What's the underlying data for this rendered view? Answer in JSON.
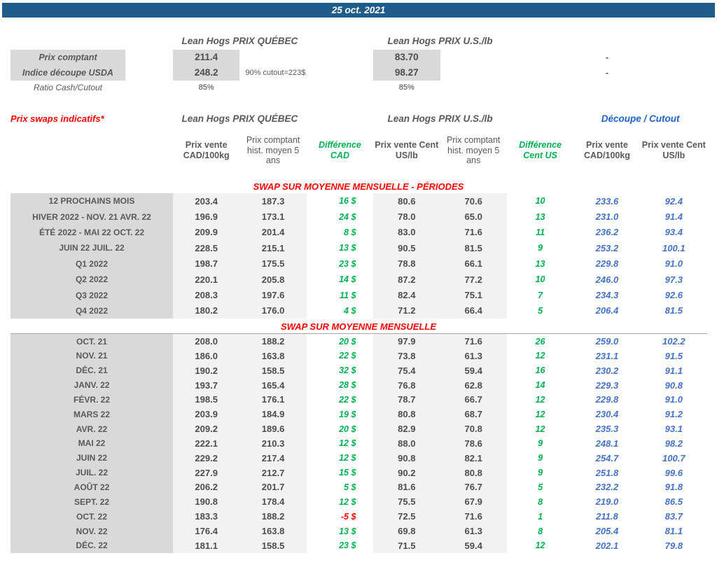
{
  "colors": {
    "banner_bg": "#1F5C8B",
    "section_red": "#FF0000",
    "difference_green": "#00B050",
    "cutout_blue": "#4472C4",
    "cutout_header_blue": "#2064C8",
    "label_column_bg": "#D9D9D9",
    "data_band_bg": "#F2F2F2"
  },
  "banner": {
    "date": "25 oct. 2021"
  },
  "spot": {
    "quebec_header": "Lean Hogs PRIX QUÉBEC",
    "us_header": "Lean Hogs PRIX U.S./lb",
    "rows": [
      {
        "label": "Prix comptant",
        "qc": "211.4",
        "note": "",
        "us": "83.70",
        "cutout_cad": "-"
      },
      {
        "label": "Indice découpe USDA",
        "qc": "248.2",
        "note": "90% cutout=223$",
        "us": "98.27",
        "cutout_cad": "-"
      },
      {
        "label": "Ratio Cash/Cutout",
        "qc": "85%",
        "note": "",
        "us": "85%",
        "cutout_cad": ""
      }
    ]
  },
  "swaps": {
    "note": "Prix swaps indicatifs*",
    "quebec_header": "Lean Hogs PRIX QUÉBEC",
    "us_header": "Lean Hogs PRIX U.S./lb",
    "cutout_header": "Découpe / Cutout",
    "columns": [
      "Prix vente CAD/100kg",
      "Prix comptant hist. moyen 5 ans",
      "Différence CAD",
      "Prix vente Cent US/lb",
      "Prix comptant hist. moyen 5 ans",
      "Différence Cent US",
      "Prix vente CAD/100kg",
      "Prix vente Cent US/lb"
    ],
    "sections": [
      {
        "title": "SWAP SUR MOYENNE MENSUELLE - PÉRIODES",
        "rows": [
          {
            "label": "12 PROCHAINS MOIS",
            "qc_sell": "203.4",
            "qc_hist": "187.3",
            "diff_cad": "16 $",
            "us_sell": "80.6",
            "us_hist": "70.6",
            "diff_us": "10",
            "cut_cad": "233.6",
            "cut_us": "92.4"
          },
          {
            "label": "HIVER 2022 - NOV. 21 AVR. 22",
            "qc_sell": "196.9",
            "qc_hist": "173.1",
            "diff_cad": "24 $",
            "us_sell": "78.0",
            "us_hist": "65.0",
            "diff_us": "13",
            "cut_cad": "231.0",
            "cut_us": "91.4"
          },
          {
            "label": "ÉTÉ 2022 - MAI 22 OCT. 22",
            "qc_sell": "209.9",
            "qc_hist": "201.4",
            "diff_cad": "8 $",
            "us_sell": "83.0",
            "us_hist": "71.6",
            "diff_us": "11",
            "cut_cad": "236.2",
            "cut_us": "93.4"
          },
          {
            "label": "JUIN 22 JUIL. 22",
            "qc_sell": "228.5",
            "qc_hist": "215.1",
            "diff_cad": "13 $",
            "us_sell": "90.5",
            "us_hist": "81.5",
            "diff_us": "9",
            "cut_cad": "253.2",
            "cut_us": "100.1"
          },
          {
            "label": "Q1 2022",
            "qc_sell": "198.7",
            "qc_hist": "175.5",
            "diff_cad": "23 $",
            "us_sell": "78.8",
            "us_hist": "66.1",
            "diff_us": "13",
            "cut_cad": "229.8",
            "cut_us": "91.0"
          },
          {
            "label": "Q2 2022",
            "qc_sell": "220.1",
            "qc_hist": "205.8",
            "diff_cad": "14 $",
            "us_sell": "87.2",
            "us_hist": "77.2",
            "diff_us": "10",
            "cut_cad": "246.0",
            "cut_us": "97.3"
          },
          {
            "label": "Q3 2022",
            "qc_sell": "208.3",
            "qc_hist": "197.6",
            "diff_cad": "11 $",
            "us_sell": "82.4",
            "us_hist": "75.1",
            "diff_us": "7",
            "cut_cad": "234.3",
            "cut_us": "92.6"
          },
          {
            "label": "Q4 2022",
            "qc_sell": "180.2",
            "qc_hist": "176.0",
            "diff_cad": "4 $",
            "us_sell": "71.2",
            "us_hist": "66.4",
            "diff_us": "5",
            "cut_cad": "206.4",
            "cut_us": "81.5"
          }
        ]
      },
      {
        "title": "SWAP SUR MOYENNE MENSUELLE",
        "rows": [
          {
            "label": "OCT. 21",
            "qc_sell": "208.0",
            "qc_hist": "188.2",
            "diff_cad": "20 $",
            "us_sell": "97.9",
            "us_hist": "71.6",
            "diff_us": "26",
            "cut_cad": "259.0",
            "cut_us": "102.2"
          },
          {
            "label": "NOV. 21",
            "qc_sell": "186.0",
            "qc_hist": "163.8",
            "diff_cad": "22 $",
            "us_sell": "73.8",
            "us_hist": "61.3",
            "diff_us": "12",
            "cut_cad": "231.1",
            "cut_us": "91.5"
          },
          {
            "label": "DÉC. 21",
            "qc_sell": "190.2",
            "qc_hist": "158.5",
            "diff_cad": "32 $",
            "us_sell": "75.4",
            "us_hist": "59.4",
            "diff_us": "16",
            "cut_cad": "230.2",
            "cut_us": "91.1"
          },
          {
            "label": "JANV. 22",
            "qc_sell": "193.7",
            "qc_hist": "165.4",
            "diff_cad": "28 $",
            "us_sell": "76.8",
            "us_hist": "62.8",
            "diff_us": "14",
            "cut_cad": "229.3",
            "cut_us": "90.8"
          },
          {
            "label": "FÉVR. 22",
            "qc_sell": "198.5",
            "qc_hist": "176.1",
            "diff_cad": "22 $",
            "us_sell": "78.7",
            "us_hist": "66.7",
            "diff_us": "12",
            "cut_cad": "229.8",
            "cut_us": "91.0"
          },
          {
            "label": "MARS 22",
            "qc_sell": "203.9",
            "qc_hist": "184.9",
            "diff_cad": "19 $",
            "us_sell": "80.8",
            "us_hist": "68.7",
            "diff_us": "12",
            "cut_cad": "230.4",
            "cut_us": "91.2"
          },
          {
            "label": "AVR. 22",
            "qc_sell": "209.2",
            "qc_hist": "189.6",
            "diff_cad": "20 $",
            "us_sell": "82.9",
            "us_hist": "70.8",
            "diff_us": "12",
            "cut_cad": "235.3",
            "cut_us": "93.1"
          },
          {
            "label": "MAI 22",
            "qc_sell": "222.1",
            "qc_hist": "210.3",
            "diff_cad": "12 $",
            "us_sell": "88.0",
            "us_hist": "78.6",
            "diff_us": "9",
            "cut_cad": "248.1",
            "cut_us": "98.2"
          },
          {
            "label": "JUIN 22",
            "qc_sell": "229.2",
            "qc_hist": "217.4",
            "diff_cad": "12 $",
            "us_sell": "90.8",
            "us_hist": "82.1",
            "diff_us": "9",
            "cut_cad": "254.7",
            "cut_us": "100.7"
          },
          {
            "label": "JUIL. 22",
            "qc_sell": "227.9",
            "qc_hist": "212.7",
            "diff_cad": "15 $",
            "us_sell": "90.2",
            "us_hist": "80.8",
            "diff_us": "9",
            "cut_cad": "251.8",
            "cut_us": "99.6"
          },
          {
            "label": "AOÛT 22",
            "qc_sell": "206.2",
            "qc_hist": "201.7",
            "diff_cad": "5 $",
            "us_sell": "81.6",
            "us_hist": "76.7",
            "diff_us": "5",
            "cut_cad": "232.2",
            "cut_us": "91.8"
          },
          {
            "label": "SEPT. 22",
            "qc_sell": "190.8",
            "qc_hist": "178.4",
            "diff_cad": "12 $",
            "us_sell": "75.5",
            "us_hist": "67.9",
            "diff_us": "8",
            "cut_cad": "219.0",
            "cut_us": "86.5"
          },
          {
            "label": "OCT. 22",
            "qc_sell": "183.3",
            "qc_hist": "188.2",
            "diff_cad": "-5 $",
            "us_sell": "72.5",
            "us_hist": "71.6",
            "diff_us": "1",
            "cut_cad": "211.8",
            "cut_us": "83.7"
          },
          {
            "label": "NOV. 22",
            "qc_sell": "176.4",
            "qc_hist": "163.8",
            "diff_cad": "13 $",
            "us_sell": "69.8",
            "us_hist": "61.3",
            "diff_us": "8",
            "cut_cad": "205.4",
            "cut_us": "81.1"
          },
          {
            "label": "DÉC. 22",
            "qc_sell": "181.1",
            "qc_hist": "158.5",
            "diff_cad": "23 $",
            "us_sell": "71.5",
            "us_hist": "59.4",
            "diff_us": "12",
            "cut_cad": "202.1",
            "cut_us": "79.8"
          }
        ]
      }
    ]
  }
}
